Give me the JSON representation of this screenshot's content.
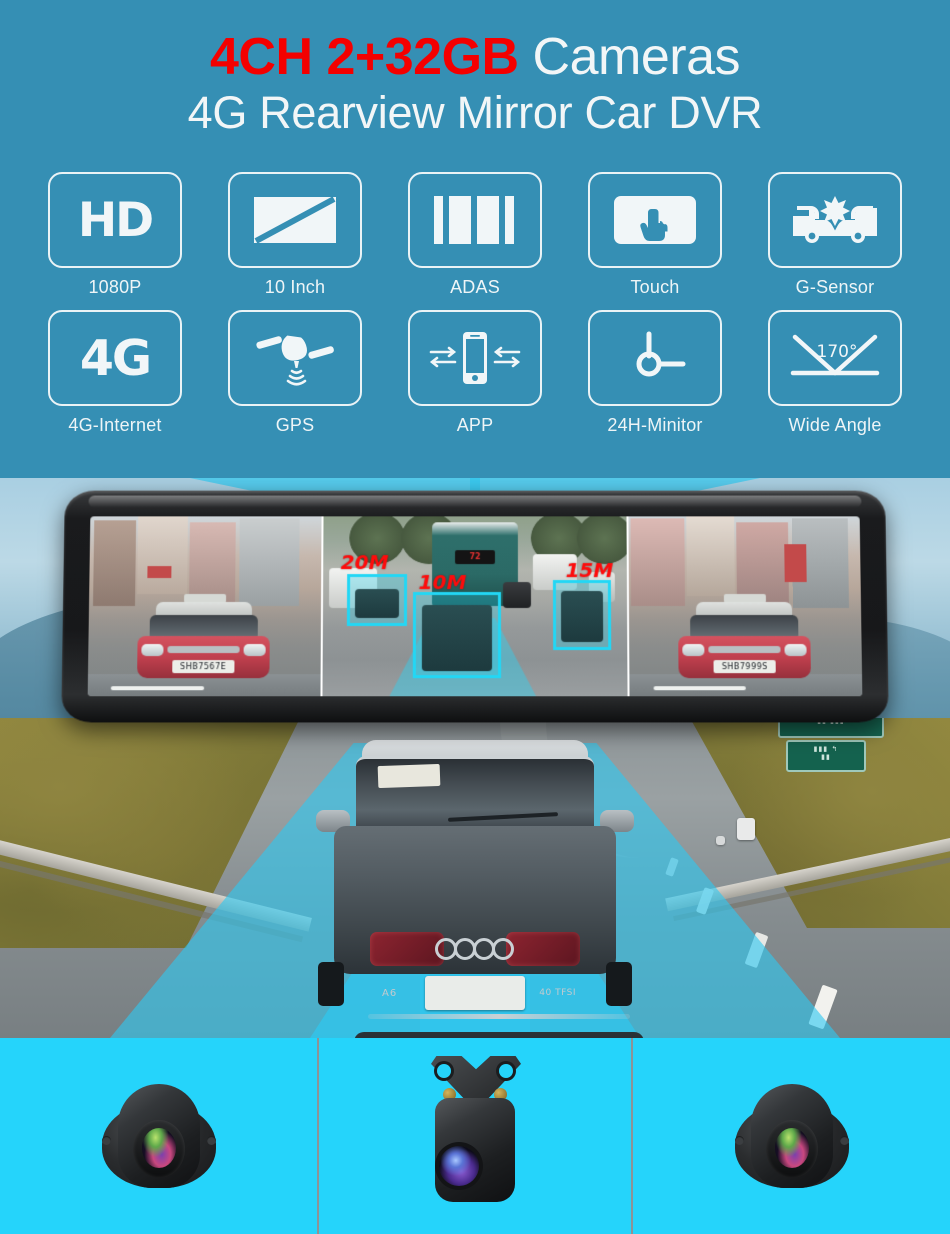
{
  "header": {
    "title_line1_highlight": "4CH 2+32GB",
    "title_line1_rest": "Cameras",
    "title_line2": "4G Rearview Mirror Car DVR",
    "colors": {
      "background": "#358fb4",
      "highlight_red": "#f40000",
      "text_white": "#f2f6f7"
    }
  },
  "features": {
    "row1": [
      {
        "icon": "hd-icon",
        "glyph": "HD",
        "label": "1080P"
      },
      {
        "icon": "screen-icon",
        "glyph": "",
        "label": "10 Inch"
      },
      {
        "icon": "adas-lane-icon",
        "glyph": "",
        "label": "ADAS"
      },
      {
        "icon": "touch-hand-icon",
        "glyph": "",
        "label": "Touch"
      },
      {
        "icon": "collision-icon",
        "glyph": "",
        "label": "G-Sensor"
      }
    ],
    "row2": [
      {
        "icon": "4g-icon",
        "glyph": "4G",
        "label": "4G-Internet"
      },
      {
        "icon": "satellite-icon",
        "glyph": "",
        "label": "GPS"
      },
      {
        "icon": "smartphone-app-icon",
        "glyph": "",
        "label": "APP"
      },
      {
        "icon": "clock-icon",
        "glyph": "",
        "label": "24H-Minitor"
      },
      {
        "icon": "wide-angle-icon",
        "glyph": "170°",
        "label": "Wide Angle"
      }
    ]
  },
  "mirror_display": {
    "channels": [
      {
        "name": "front-left-camera-view",
        "plate": "SHB7567E"
      },
      {
        "name": "adas-center-camera-view",
        "plate": ""
      },
      {
        "name": "front-right-camera-view",
        "plate": "SHB7999S"
      }
    ],
    "adas_labels": [
      {
        "text": "20M"
      },
      {
        "text": "10M"
      },
      {
        "text": "15M"
      }
    ],
    "bus_destination": "72",
    "detection_color": "#22d7f5",
    "label_color": "#ff0b0b"
  },
  "road_scene": {
    "vehicle_badge_model": "A6",
    "vehicle_badge_engine": "40 TFSI",
    "coverage_color": "#2ec8f0"
  },
  "camera_strip": {
    "background": "#25d4fb",
    "panels": [
      {
        "name": "left-side-camera"
      },
      {
        "name": "rear-camera-with-bracket"
      },
      {
        "name": "right-side-camera"
      }
    ]
  }
}
